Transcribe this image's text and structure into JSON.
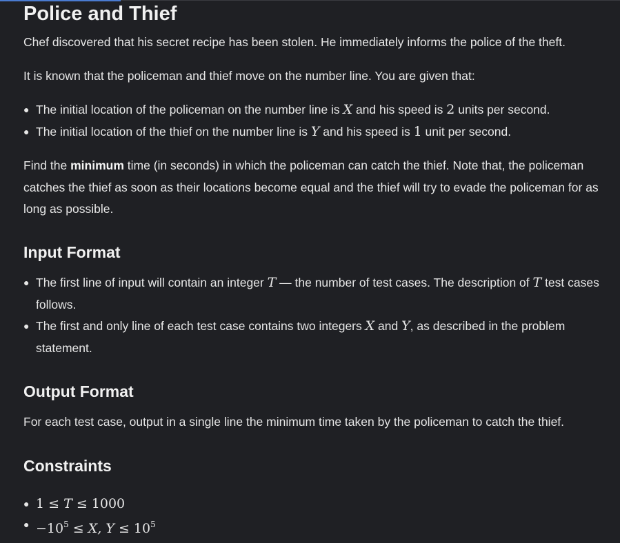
{
  "title": "Police and Thief",
  "statement": {
    "intro": "Chef discovered that his secret recipe has been stolen. He immediately informs the police of the theft.",
    "known": "It is known that the policeman and thief move on the number line. You are given that:",
    "bullet1": {
      "before": "The initial location of the policeman on the number line is ",
      "var": "X",
      "middle": " and his speed is ",
      "num": "2",
      "after": " units per second."
    },
    "bullet2": {
      "before": "The initial location of the thief on the number line is ",
      "var": "Y",
      "middle": " and his speed is ",
      "num": "1",
      "after": " unit per second."
    },
    "find_before": "Find the ",
    "find_bold": "minimum",
    "find_after": " time (in seconds) in which the policeman can catch the thief. Note that, the policeman catches the thief as soon as their locations become equal and the thief will try to evade the policeman for as long as possible."
  },
  "input_format": {
    "heading": "Input Format",
    "bullet1": {
      "before": "The first line of input will contain an integer ",
      "var1": "T",
      "middle": " — the number of test cases. The description of ",
      "var2": "T",
      "after": " test cases follows."
    },
    "bullet2": {
      "before": "The first and only line of each test case contains two integers ",
      "var1": "X",
      "middle": " and ",
      "var2": "Y",
      "after": ", as described in the problem statement."
    }
  },
  "output_format": {
    "heading": "Output Format",
    "text": "For each test case, output in a single line the minimum time taken by the policeman to catch the thief."
  },
  "constraints": {
    "heading": "Constraints",
    "c1": {
      "lhs": "1",
      "le1": " ≤ ",
      "var": "T",
      "le2": " ≤ ",
      "rhs": "1000"
    },
    "c2": {
      "neg": "−10",
      "exp1": "5",
      "le1": " ≤ ",
      "vars": "X, Y",
      "le2": " ≤ ",
      "base": "10",
      "exp2": "5"
    }
  },
  "colors": {
    "background": "#1f2024",
    "text": "#e6e6e6",
    "accent": "#4a7bd0"
  }
}
